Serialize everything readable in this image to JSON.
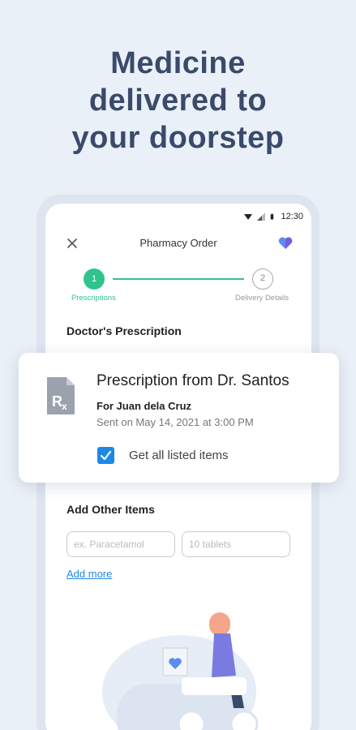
{
  "headline": {
    "line1": "Medicine",
    "line2": "delivered to",
    "line3": "your doorstep"
  },
  "status_bar": {
    "time": "12:30"
  },
  "header": {
    "title": "Pharmacy Order"
  },
  "stepper": {
    "step1": {
      "number": "1",
      "label": "Prescriptions"
    },
    "step2": {
      "number": "2",
      "label": "Delivery Details"
    }
  },
  "prescription_section": {
    "title": "Doctor's Prescription"
  },
  "card": {
    "title": "Prescription from Dr. Santos",
    "for": "For Juan dela Cruz",
    "sent": "Sent on May 14, 2021 at 3:00 PM",
    "checkbox_label": "Get all listed items",
    "checked": true
  },
  "other_items": {
    "title": "Add Other Items",
    "medicine_placeholder": "ex. Paracetamol",
    "quantity_placeholder": "10 tablets",
    "add_more": "Add more"
  },
  "colors": {
    "accent_green": "#2fc48d",
    "accent_blue": "#1e88e5",
    "headline": "#3a4a6a",
    "background": "#eaf0f7"
  }
}
